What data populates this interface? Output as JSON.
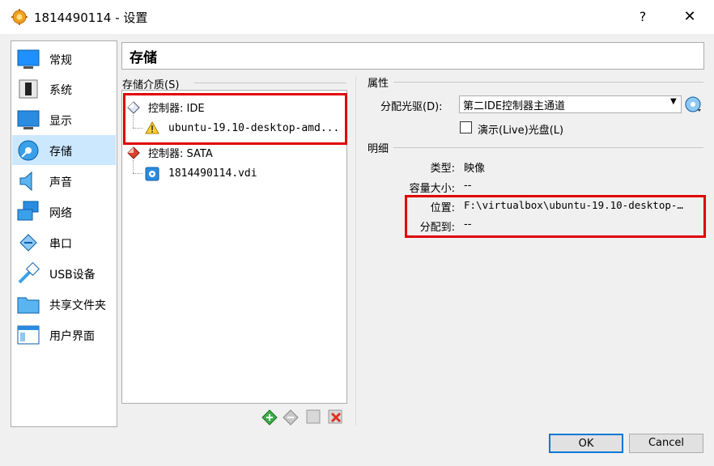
{
  "window": {
    "title": "1814490114 - 设置",
    "help": "?",
    "close": "✕"
  },
  "nav": {
    "items": [
      {
        "label": "常规"
      },
      {
        "label": "系统"
      },
      {
        "label": "显示"
      },
      {
        "label": "存储"
      },
      {
        "label": "声音"
      },
      {
        "label": "网络"
      },
      {
        "label": "串口"
      },
      {
        "label": "USB设备"
      },
      {
        "label": "共享文件夹"
      },
      {
        "label": "用户界面"
      }
    ],
    "selected": "存储"
  },
  "page": {
    "title": "存储"
  },
  "storage": {
    "section_label": "存储介质(S)",
    "tree": [
      {
        "label": "控制器: IDE"
      },
      {
        "label": "ubuntu-19.10-desktop-amd..."
      },
      {
        "label": "控制器: SATA"
      },
      {
        "label": "1814490114.vdi"
      }
    ]
  },
  "attributes": {
    "section_label": "属性",
    "drive_label": "分配光驱(D):",
    "drive_value": "第二IDE控制器主通道",
    "live_label": "演示(Live)光盘(L)",
    "live_checked": false
  },
  "details": {
    "section_label": "明细",
    "type_key": "类型:",
    "type_value": "映像",
    "size_key": "容量大小:",
    "size_value": "--",
    "location_key": "位置:",
    "location_value": "F:\\virtualbox\\ubuntu-19.10-desktop-…",
    "attached_key": "分配到:",
    "attached_value": "--"
  },
  "buttons": {
    "ok": "OK",
    "cancel": "Cancel"
  },
  "colors": {
    "selection": "#cce8ff",
    "highlight_box": "#e00000",
    "default_button_border": "#0078d7"
  }
}
